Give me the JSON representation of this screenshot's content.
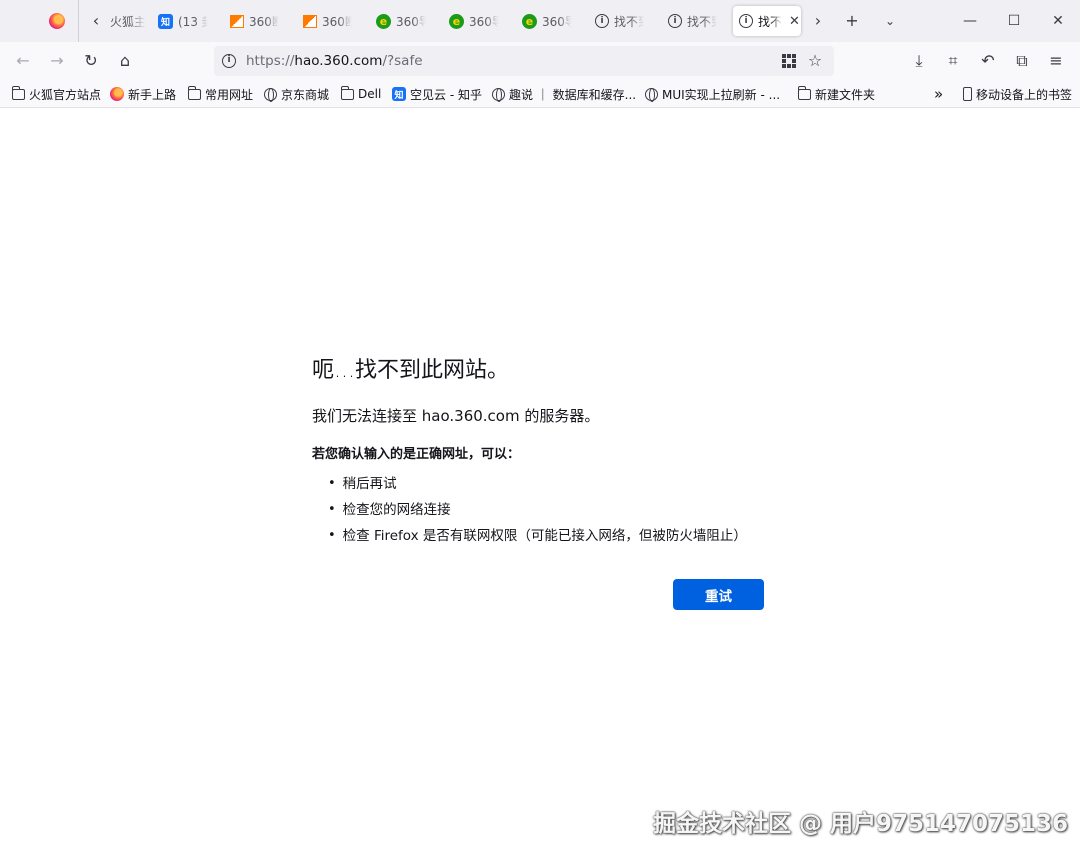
{
  "tabs": [
    {
      "label": "火狐主",
      "icon": "chevron-left-icon",
      "favicon": "none"
    },
    {
      "label": "(13 封",
      "favicon": "zhihu-icon",
      "favicon_text": "知"
    },
    {
      "label": "360断",
      "favicon": "360-flag-icon"
    },
    {
      "label": "360断",
      "favicon": "360-flag-icon"
    },
    {
      "label": "360导",
      "favicon": "360-nav-icon"
    },
    {
      "label": "360导",
      "favicon": "360-nav-icon"
    },
    {
      "label": "360导",
      "favicon": "360-nav-icon"
    },
    {
      "label": "找不到",
      "favicon": "info-icon"
    },
    {
      "label": "找不到",
      "favicon": "info-icon"
    },
    {
      "label": "找不",
      "favicon": "info-icon",
      "active": true
    }
  ],
  "url": {
    "prefix": "https://",
    "host": "hao.360.com",
    "suffix": "/?safe"
  },
  "bookmarks": [
    {
      "label": "火狐官方站点",
      "icon": "folder-icon"
    },
    {
      "label": "新手上路",
      "icon": "firefox-icon"
    },
    {
      "label": "常用网址",
      "icon": "folder-icon"
    },
    {
      "label": "京东商城",
      "icon": "globe-icon"
    },
    {
      "label": "Dell",
      "icon": "folder-icon"
    },
    {
      "label": "空见云 - 知乎",
      "icon": "zhihu-icon",
      "icon_text": "知"
    },
    {
      "label": "趣说 ｜ 数据库和缓存...",
      "icon": "globe-icon"
    },
    {
      "label": "MUI实现上拉刷新 - ...",
      "icon": "globe-icon"
    },
    {
      "label": "新建文件夹",
      "icon": "folder-icon"
    }
  ],
  "bookmarks_overflow": "»",
  "mobile_bookmarks": "移动设备上的书签",
  "error": {
    "title": "呃...找不到此网站。",
    "description": "我们无法连接至 hao.360.com 的服务器。",
    "hint": "若您确认输入的是正确网址，可以：",
    "suggestions": [
      "稍后再试",
      "检查您的网络连接",
      "检查 Firefox 是否有联网权限（可能已接入网络，但被防火墙阻止）"
    ],
    "retry_label": "重试"
  },
  "watermark": "掘金技术社区 @ 用户975147075136",
  "colors": {
    "accent": "#0061e0",
    "tabstrip_bg": "#f0f0f4",
    "toolbar_bg": "#f9f9fb"
  }
}
